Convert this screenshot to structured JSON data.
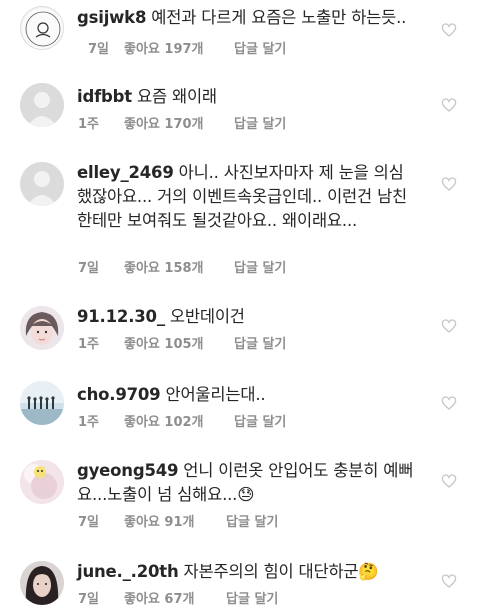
{
  "comments": [
    {
      "username": "gsijwk8",
      "text": "예전과 다르게 요즘은 노출만 하는듯..",
      "time": "7일",
      "likes_label": "좋아요",
      "likes_count": "197개",
      "reply": "답글 달기"
    },
    {
      "username": "idfbbt",
      "text": "요즘 왜이래",
      "time": "1주",
      "likes_label": "좋아요",
      "likes_count": "170개",
      "reply": "답글 달기"
    },
    {
      "username": "elley_2469",
      "text": "아니.. 사진보자마자 제 눈을 의심했잖아요... 거의 이벤트속옷급인데.. 이런건 남친한테만 보여줘도 될것같아요.. 왜이래요...",
      "time": "7일",
      "likes_label": "좋아요",
      "likes_count": "158개",
      "reply": "답글 달기"
    },
    {
      "username": "91.12.30_",
      "text": "오반데이건",
      "time": "1주",
      "likes_label": "좋아요",
      "likes_count": "105개",
      "reply": "답글 달기"
    },
    {
      "username": "cho.9709",
      "text": "안어울리는대..",
      "time": "1주",
      "likes_label": "좋아요",
      "likes_count": "102개",
      "reply": "답글 달기"
    },
    {
      "username": "gyeong549",
      "text": "언니 이런옷 안입어도 충분히 예뻐요...노출이 넘 심해요...😓",
      "time": "7일",
      "likes_label": "좋아요",
      "likes_count": "91개",
      "reply": "답글 달기"
    },
    {
      "username": "june._.20th",
      "text": "자본주의의 힘이 대단하군🤔",
      "time": "7일",
      "likes_label": "좋아요",
      "likes_count": "67개",
      "reply": "답글 달기"
    }
  ],
  "avatar_icons": [
    "avatar-icon",
    "default-avatar-icon",
    "default-avatar-icon",
    "avatar-icon",
    "avatar-icon",
    "avatar-icon",
    "avatar-icon"
  ],
  "colors": {
    "meta_gray": "#8e8e8e",
    "text": "#262626",
    "heart": "#c7c7c7"
  }
}
